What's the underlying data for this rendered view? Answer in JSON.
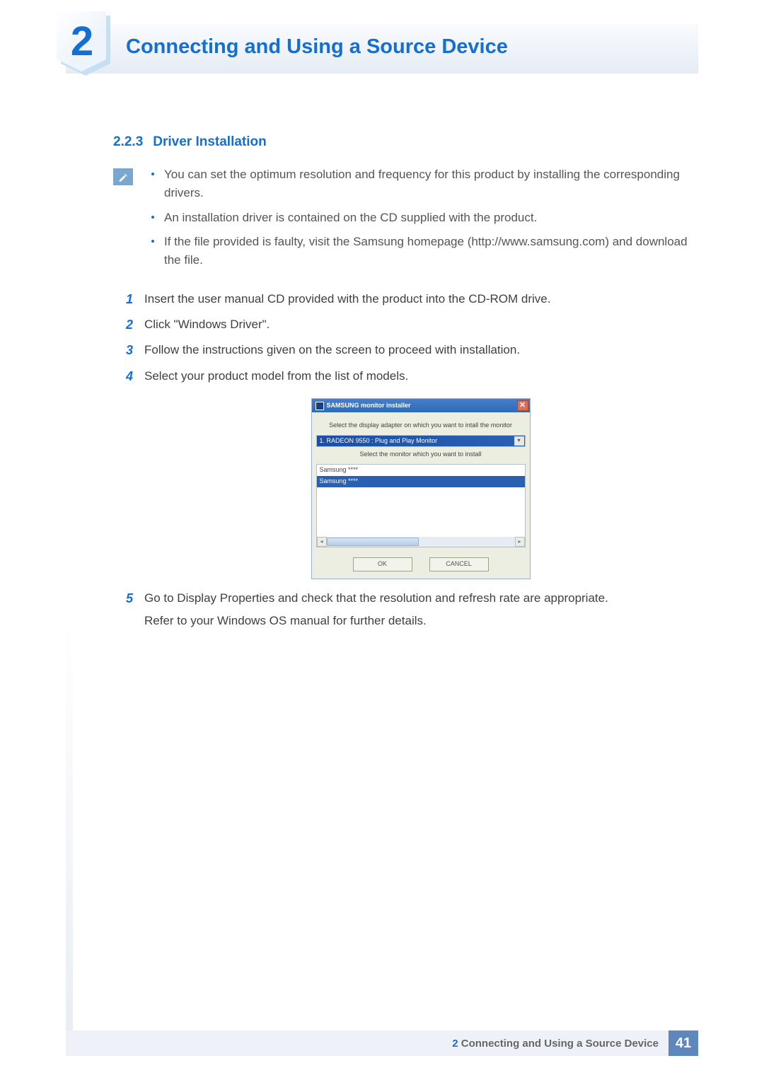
{
  "chapter": {
    "number": "2",
    "title": "Connecting and Using a Source Device"
  },
  "section": {
    "number": "2.2.3",
    "title": "Driver Installation"
  },
  "note_bullets": [
    "You can set the optimum resolution and frequency for this product by installing the corresponding drivers.",
    "An installation driver is contained on the CD supplied with the product.",
    "If the file provided is faulty, visit the Samsung homepage (http://www.samsung.com) and download the file."
  ],
  "steps": [
    {
      "n": "1",
      "text": "Insert the user manual CD provided with the product into the CD-ROM drive."
    },
    {
      "n": "2",
      "text": "Click \"Windows Driver\"."
    },
    {
      "n": "3",
      "text": "Follow the instructions given on the screen to proceed with installation."
    },
    {
      "n": "4",
      "text": "Select your product model from the list of models."
    },
    {
      "n": "5",
      "text": "Go to Display Properties and check that the resolution and refresh rate are appropriate.",
      "after": "Refer to your Windows OS manual for further details."
    }
  ],
  "installer": {
    "title": "SAMSUNG monitor installer",
    "label_adapter": "Select the display adapter on which you want to intall the monitor",
    "combo_value": "1. RADEON 9550 : Plug and Play Monitor",
    "label_monitor": "Select the monitor which you want to install",
    "list_items": [
      "Samsung ****",
      "Samsung ****"
    ],
    "btn_ok": "OK",
    "btn_cancel": "CANCEL"
  },
  "footer": {
    "chapter_num": "2",
    "chapter_title": "Connecting and Using a Source Device",
    "page": "41"
  }
}
